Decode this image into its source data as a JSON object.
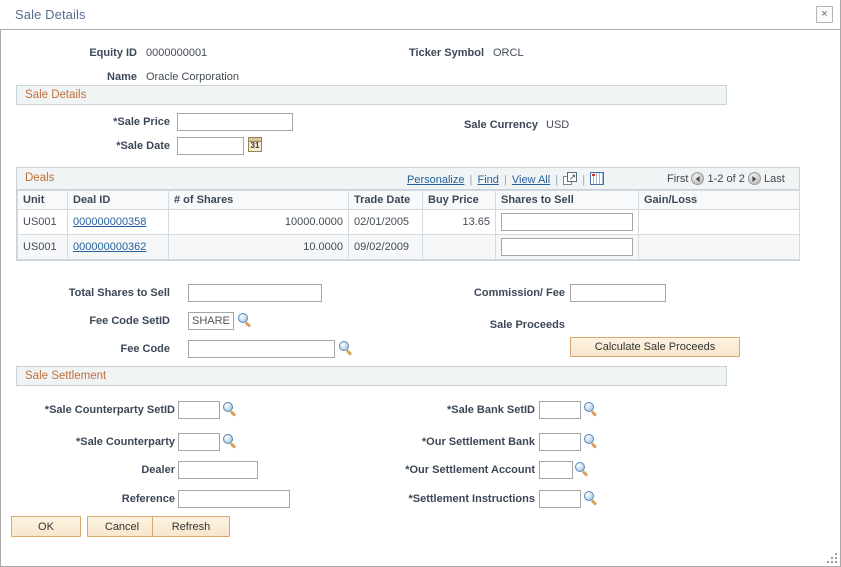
{
  "window": {
    "title": "Sale Details",
    "close_label": "×"
  },
  "header": {
    "equity_id_label": "Equity ID",
    "equity_id_value": "0000000001",
    "ticker_label": "Ticker Symbol",
    "ticker_value": "ORCL",
    "name_label": "Name",
    "name_value": "Oracle Corporation"
  },
  "sale_details": {
    "section_title": "Sale Details",
    "sale_price_label": "*Sale Price",
    "sale_price_value": "",
    "sale_date_label": "*Sale Date",
    "sale_date_value": "",
    "calendar_day": "31",
    "sale_currency_label": "Sale Currency",
    "sale_currency_value": "USD"
  },
  "deals": {
    "grid_title": "Deals",
    "links": {
      "personalize": "Personalize",
      "find": "Find",
      "view_all": "View All",
      "separator": "|"
    },
    "nav": {
      "first": "First",
      "range": "1-2 of 2",
      "last": "Last"
    },
    "columns": [
      "Unit",
      "Deal ID",
      "# of Shares",
      "Trade Date",
      "Buy Price",
      "Shares to Sell",
      "Gain/Loss"
    ],
    "rows": [
      {
        "unit": "US001",
        "deal_id": "000000000358",
        "shares": "10000.0000",
        "trade_date": "02/01/2005",
        "buy_price": "13.65",
        "shares_to_sell": "",
        "gain_loss": ""
      },
      {
        "unit": "US001",
        "deal_id": "000000000362",
        "shares": "10.0000",
        "trade_date": "09/02/2009",
        "buy_price": "",
        "shares_to_sell": "",
        "gain_loss": ""
      }
    ]
  },
  "totals": {
    "total_shares_label": "Total Shares to Sell",
    "total_shares_value": "",
    "fee_code_setid_label": "Fee Code SetID",
    "fee_code_setid_value": "SHARE",
    "fee_code_label": "Fee Code",
    "fee_code_value": "",
    "commission_label": "Commission/ Fee",
    "commission_value": "",
    "sale_proceeds_label": "Sale Proceeds",
    "calculate_button": "Calculate Sale Proceeds"
  },
  "settlement": {
    "section_title": "Sale Settlement",
    "sale_counterparty_setid_label": "*Sale Counterparty SetID",
    "sale_counterparty_setid_value": "",
    "sale_counterparty_label": "*Sale Counterparty",
    "sale_counterparty_value": "",
    "dealer_label": "Dealer",
    "dealer_value": "",
    "reference_label": "Reference",
    "reference_value": "",
    "sale_bank_setid_label": "*Sale Bank SetID",
    "sale_bank_setid_value": "",
    "our_settlement_bank_label": "*Our Settlement Bank",
    "our_settlement_bank_value": "",
    "our_settlement_account_label": "*Our Settlement Account",
    "our_settlement_account_value": "",
    "settlement_instructions_label": "*Settlement Instructions",
    "settlement_instructions_value": ""
  },
  "footer": {
    "ok": "OK",
    "cancel": "Cancel",
    "refresh": "Refresh"
  },
  "colors": {
    "section_title": "#c2703a",
    "link": "#26619c",
    "button_border": "#d9a86c",
    "title": "#5a6e8c"
  }
}
